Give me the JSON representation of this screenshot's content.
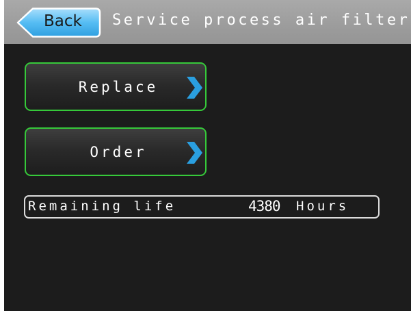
{
  "header": {
    "back_label": "Back",
    "title": "Service process air filter"
  },
  "actions": [
    {
      "label": "Replace",
      "icon": "chevron-right-icon"
    },
    {
      "label": "Order",
      "icon": "chevron-right-icon"
    }
  ],
  "remaining_life": {
    "label": "Remaining life",
    "value": "4380",
    "unit": "Hours"
  },
  "colors": {
    "header_bg": "#a0a0a0",
    "screen_bg": "#1c1c1c",
    "button_border": "#36c93a",
    "chevron": "#2a9fe0",
    "back_button": "#4fb8f0"
  }
}
